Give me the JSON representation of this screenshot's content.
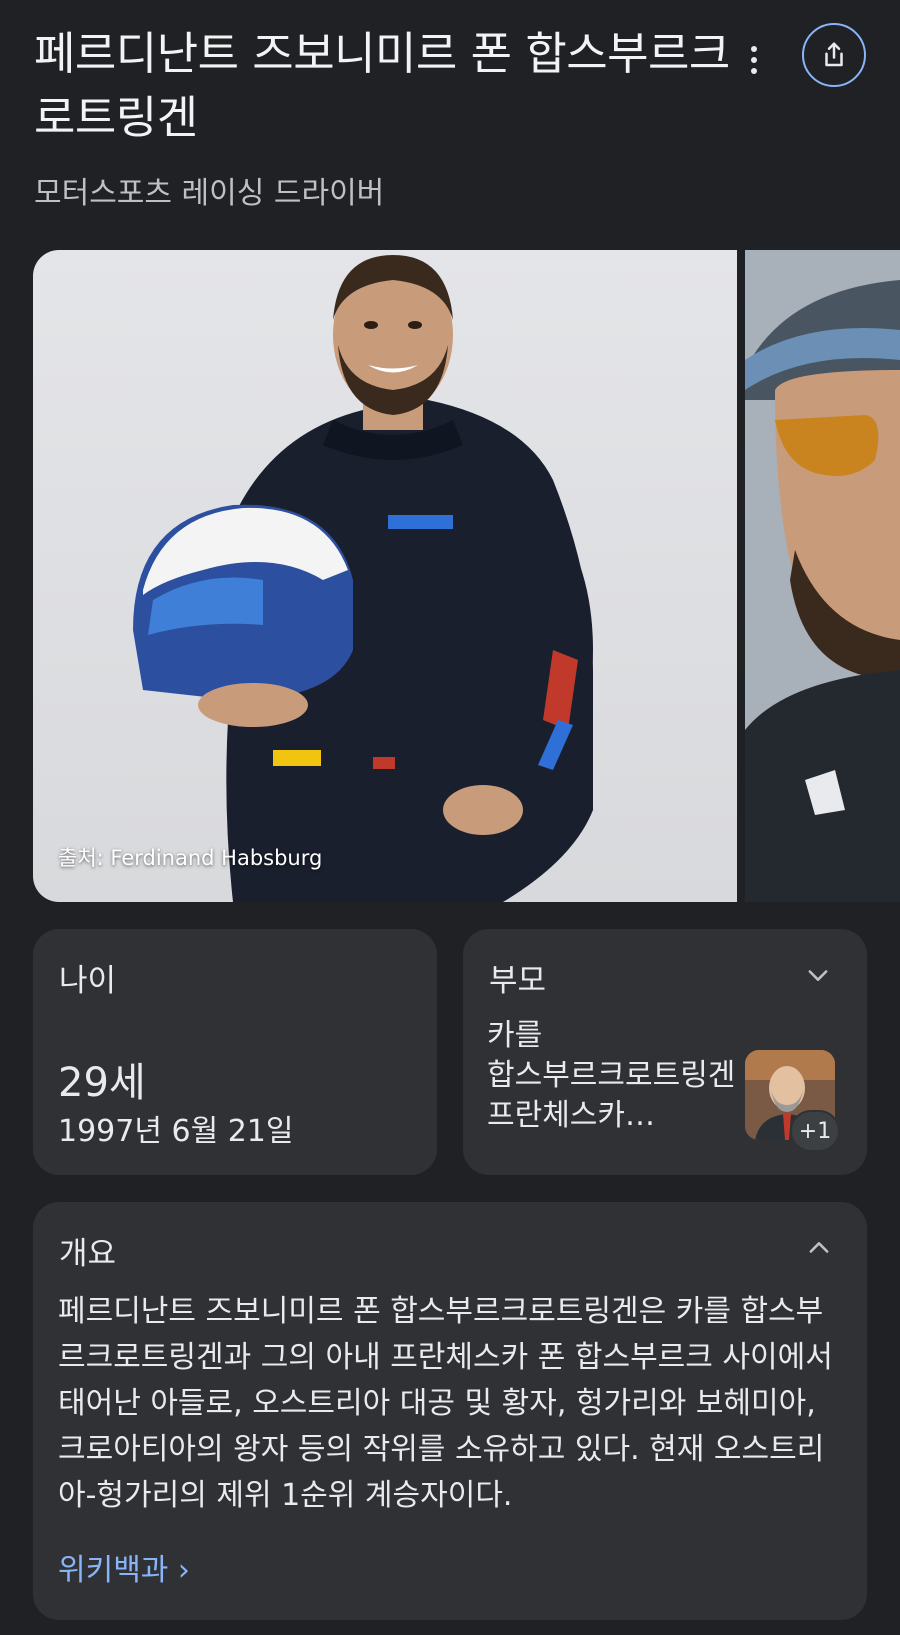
{
  "header": {
    "title": "페르디난트 즈보니미르 폰 합스부르크로트링겐",
    "subtitle": "모터스포츠 레이싱 드라이버"
  },
  "images": {
    "main_caption": "출처: Ferdinand Habsburg"
  },
  "age_card": {
    "label": "나이",
    "value": "29세",
    "birth_date": "1997년 6월 21일"
  },
  "parents_card": {
    "label": "부모",
    "names": [
      "카를",
      "합스부르크로트링겐",
      "프란체스카…"
    ],
    "more_count": "+1"
  },
  "overview_card": {
    "label": "개요",
    "text": "페르디난트 즈보니미르 폰 합스부르크로트링겐은 카를 합스부르크로트링겐과 그의 아내 프란체스카 폰 합스부르크 사이에서 태어난 아들로, 오스트리아 대공 및 황자, 헝가리와 보헤미아, 크로아티아의 왕자 등의 작위를 소유하고 있다. 현재 오스트리아-헝가리의 제위 1순위 계승자이다.",
    "link_label": "위키백과 ›"
  },
  "colors": {
    "background": "#202124",
    "card": "#303134",
    "accent": "#8ab4f8"
  }
}
